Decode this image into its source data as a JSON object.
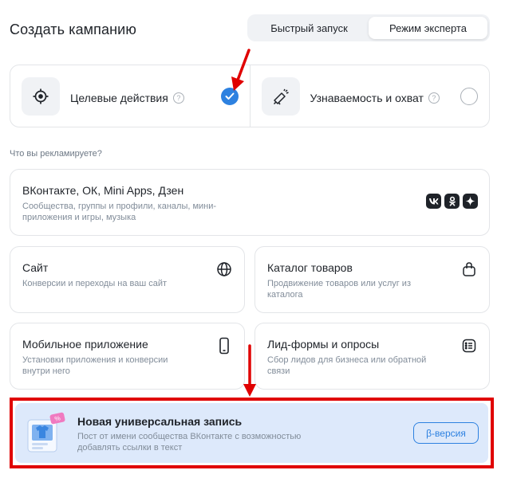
{
  "page": {
    "title": "Создать кампанию"
  },
  "mode_switch": {
    "tabs": [
      {
        "label": "Быстрый запуск",
        "active": false
      },
      {
        "label": "Режим эксперта",
        "active": true
      }
    ]
  },
  "goals": [
    {
      "label": "Целевые действия",
      "icon": "target-icon",
      "selected": true
    },
    {
      "label": "Узнаваемость и охват",
      "icon": "megaphone-icon",
      "selected": false
    }
  ],
  "section": {
    "label": "Что вы рекламируете?"
  },
  "ad_objects": {
    "vk": {
      "title": "ВКонтакте, ОК, Mini Apps, Дзен",
      "description": "Сообщества, группы и профили, каналы, мини-приложения и игры, музыка",
      "brand_icons": [
        "vk-icon",
        "ok-icon",
        "dzen-icon"
      ]
    },
    "site": {
      "title": "Сайт",
      "description": "Конверсии и переходы на ваш сайт",
      "icon": "globe-icon"
    },
    "catalog": {
      "title": "Каталог товаров",
      "description": "Продвижение товаров или услуг из каталога",
      "icon": "shopping-bag-icon"
    },
    "app": {
      "title": "Мобильное приложение",
      "description": "Установки приложения и конверсии внутри него",
      "icon": "smartphone-icon"
    },
    "leadforms": {
      "title": "Лид-формы и опросы",
      "description": "Сбор лидов для бизнеса или обратной связи",
      "icon": "list-form-icon"
    }
  },
  "promo": {
    "title": "Новая универсальная запись",
    "description": "Пост от имени сообщества ВКонтакте с возможностью добавлять ссылки в текст",
    "badge": "β-версия"
  },
  "colors": {
    "accent": "#2d81e0",
    "annotation": "#e00000",
    "promo_bg": "#dde9fb"
  }
}
